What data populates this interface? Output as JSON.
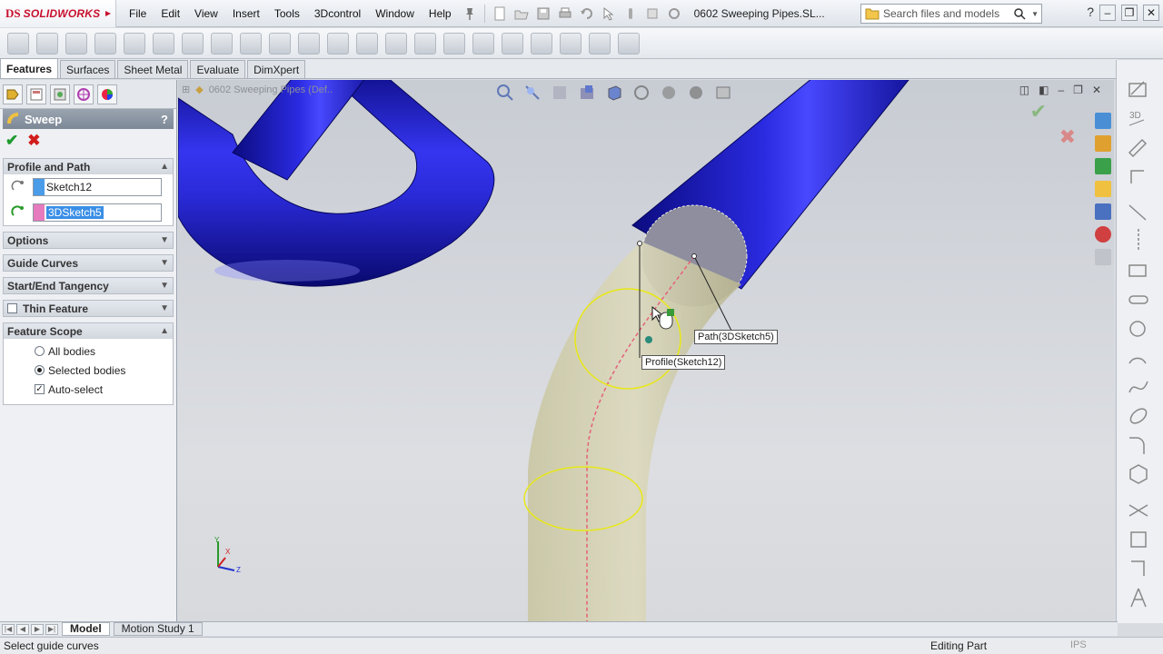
{
  "app": {
    "logo_prefix": "DS",
    "brand": "SOLIDWORKS",
    "document_title": "0602 Sweeping Pipes.SL...",
    "search_placeholder": "Search files and models"
  },
  "menu": [
    "File",
    "Edit",
    "View",
    "Insert",
    "Tools",
    "3Dcontrol",
    "Window",
    "Help"
  ],
  "tabs": [
    {
      "label": "Features",
      "active": true
    },
    {
      "label": "Surfaces",
      "active": false
    },
    {
      "label": "Sheet Metal",
      "active": false
    },
    {
      "label": "Evaluate",
      "active": false
    },
    {
      "label": "DimXpert",
      "active": false
    }
  ],
  "property_manager": {
    "title": "Sweep",
    "help": "?",
    "groups": {
      "profile_path": {
        "title": "Profile and Path",
        "profile_value": "Sketch12",
        "path_value": "3DSketch5"
      },
      "options": {
        "title": "Options"
      },
      "guide_curves": {
        "title": "Guide Curves"
      },
      "tangency": {
        "title": "Start/End Tangency"
      },
      "thin_feature": {
        "title": "Thin Feature"
      },
      "feature_scope": {
        "title": "Feature Scope",
        "opt_all": "All bodies",
        "opt_selected": "Selected bodies",
        "opt_auto": "Auto-select"
      }
    }
  },
  "viewport": {
    "tree_label": "0602 Sweeping Pipes  (Def..",
    "callout_path": "Path(3DSketch5)",
    "callout_profile": "Profile(Sketch12)",
    "triad_x": "X",
    "triad_y": "Y",
    "triad_z": "Z"
  },
  "bottom_tabs": [
    {
      "label": "Model",
      "active": true
    },
    {
      "label": "Motion Study 1",
      "active": false
    }
  ],
  "status": {
    "left": "Select guide curves",
    "right": "Editing Part",
    "units": "IPS"
  },
  "colors": {
    "pipe_blue": "#1f1fb8",
    "preview_yellow": "#c8c79a",
    "accent_red": "#c8102e",
    "sketch_yellow": "#e8e816"
  }
}
